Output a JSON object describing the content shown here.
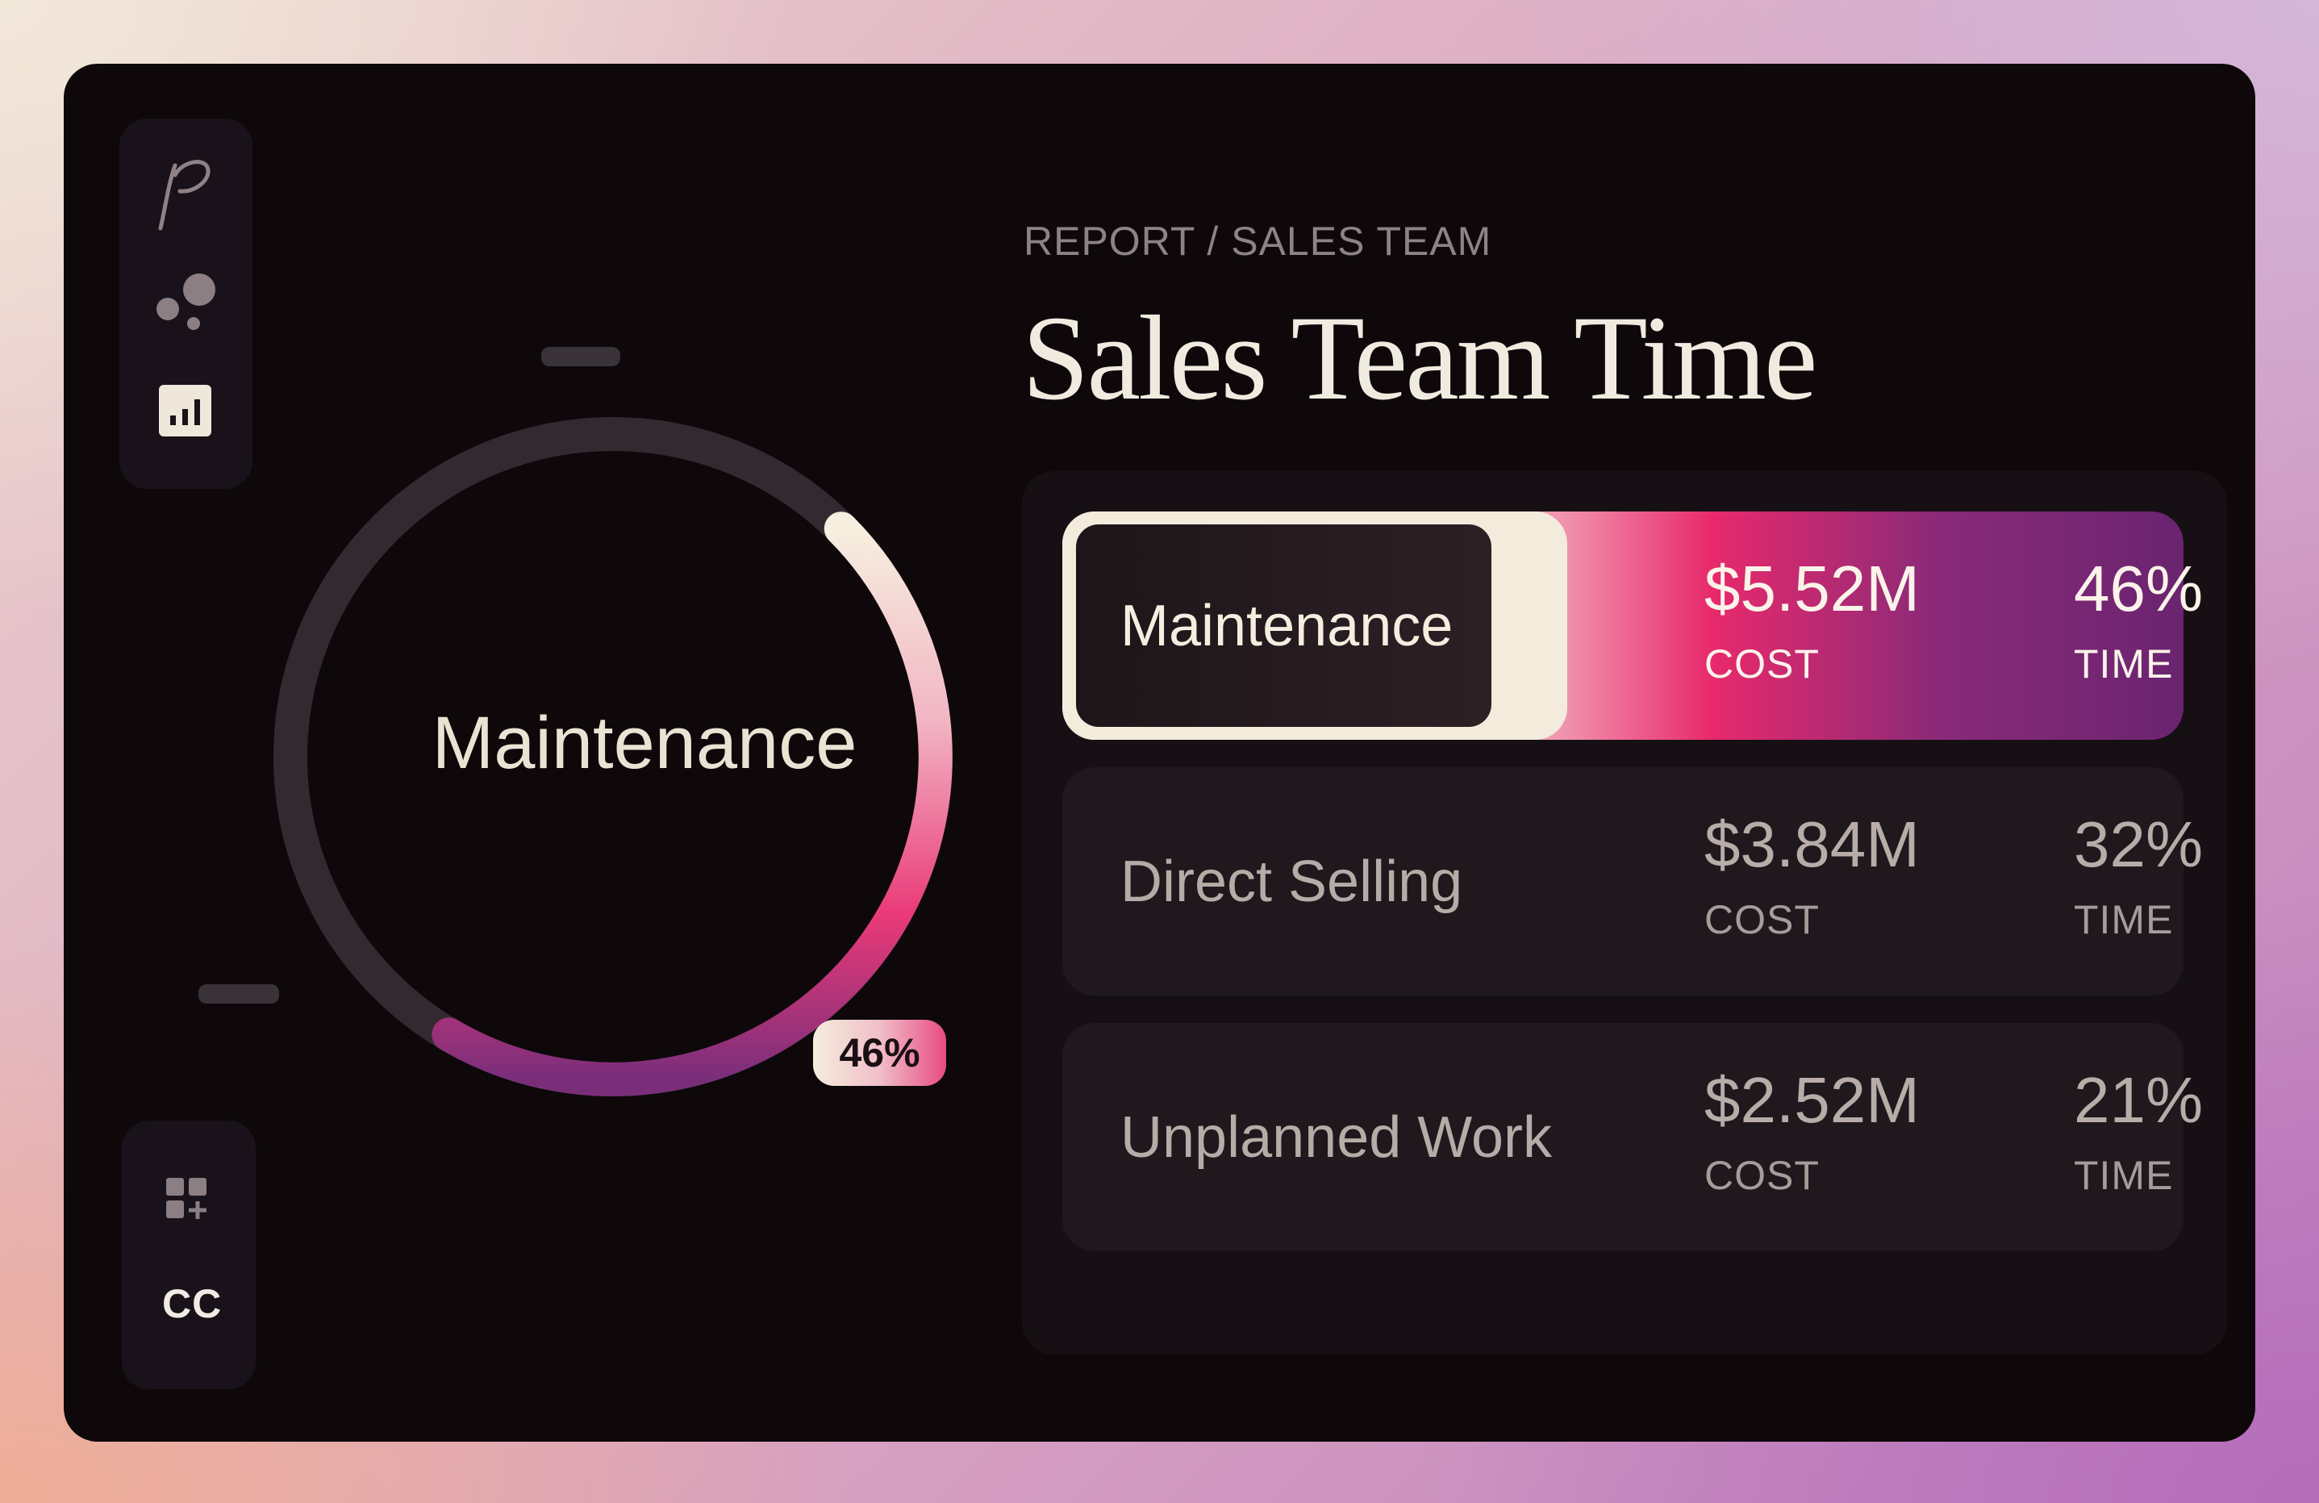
{
  "breadcrumb": "REPORT / SALES TEAM",
  "title": "Sales Team Time",
  "sidebar": {
    "icons": [
      "logo-p-icon",
      "bubbles-icon",
      "report-chart-icon"
    ],
    "bottom_icons": [
      "grid-add-icon"
    ],
    "cc_label": "CC"
  },
  "donut": {
    "center_label": "Maintenance",
    "badge": "46%",
    "highlight_fraction": 0.46,
    "colors": {
      "track": "#322a30",
      "gradient_start": "#f6efdf",
      "gradient_mid": "#ea3a78",
      "gradient_end": "#7a2e7a"
    }
  },
  "rows": [
    {
      "name": "Maintenance",
      "cost": "$5.52M",
      "cost_label": "COST",
      "time": "46%",
      "time_label": "TIME",
      "selected": true
    },
    {
      "name": "Direct Selling",
      "cost": "$3.84M",
      "cost_label": "COST",
      "time": "32%",
      "time_label": "TIME",
      "selected": false
    },
    {
      "name": "Unplanned Work",
      "cost": "$2.52M",
      "cost_label": "COST",
      "time": "21%",
      "time_label": "TIME",
      "selected": false
    }
  ],
  "colors": {
    "panel": "#0e080b",
    "accent_pink": "#e8296c",
    "accent_purple": "#6a2470",
    "cream": "#f3ebdc"
  }
}
